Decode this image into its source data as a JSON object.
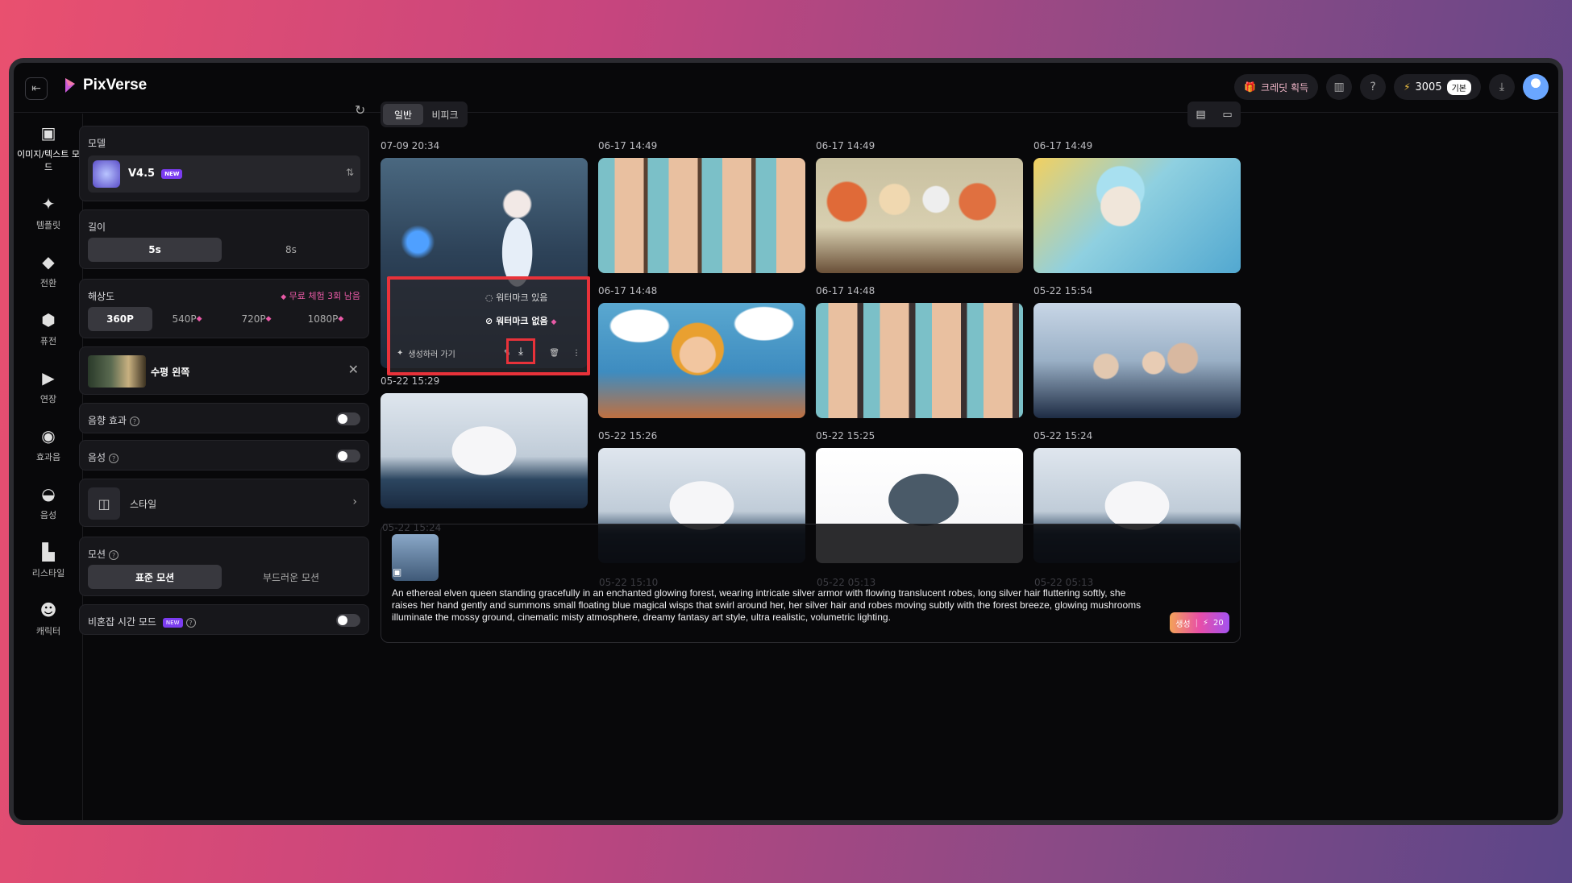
{
  "app": {
    "name": "PixVerse"
  },
  "topbar": {
    "credit_promo": "크레딧 획득",
    "credits": "3005",
    "plan": "기본"
  },
  "nav": [
    {
      "label": "이미지/텍스트 모드",
      "icon": "image-icon"
    },
    {
      "label": "템플릿",
      "icon": "sparkle-icon"
    },
    {
      "label": "전환",
      "icon": "transition-icon"
    },
    {
      "label": "퓨전",
      "icon": "cube-icon"
    },
    {
      "label": "연장",
      "icon": "extend-icon"
    },
    {
      "label": "효과음",
      "icon": "sound-wave-icon"
    },
    {
      "label": "음성",
      "icon": "lips-icon"
    },
    {
      "label": "리스타일",
      "icon": "brush-icon"
    },
    {
      "label": "캐릭터",
      "icon": "face-icon"
    }
  ],
  "settings": {
    "model_label": "모델",
    "model_name": "V4.5",
    "model_badge": "NEW",
    "length_label": "길이",
    "length_options": [
      "5s",
      "8s"
    ],
    "resolution_label": "해상도",
    "free_trial": "무료 체험 3회 남음",
    "resolution_options": [
      "360P",
      "540P",
      "720P",
      "1080P"
    ],
    "camera_move": "수평 왼쪽",
    "sound_effect_label": "음향 효과",
    "voice_label": "음성",
    "style_label": "스타일",
    "motion_label": "모션",
    "motion_options": [
      "표준 모션",
      "부드러운 모션"
    ],
    "off_peak_label": "비혼잡 시간 모드",
    "off_peak_badge": "NEW"
  },
  "gallery": {
    "tabs": [
      "일반",
      "비피크"
    ],
    "items": [
      {
        "date": "07-09 20:34"
      },
      {
        "date": "06-17 14:49"
      },
      {
        "date": "06-17 14:49"
      },
      {
        "date": "06-17 14:49"
      },
      {
        "date": "05-22 15:29"
      },
      {
        "date": "06-17 14:48"
      },
      {
        "date": "06-17 14:48"
      },
      {
        "date": "05-22 15:54"
      },
      {
        "date": "05-22 15:26"
      },
      {
        "date": "05-22 15:25"
      },
      {
        "date": "05-22 15:24"
      }
    ],
    "faded_dates": [
      "05-22 15:24",
      "05-22 15:10",
      "05-22 05:13",
      "05-22 05:13"
    ]
  },
  "popup": {
    "with_watermark": "워터마크 있음",
    "without_watermark": "워터마크 없음",
    "go_generate": "생성하러 가기"
  },
  "prompt": {
    "text": "An ethereal elven queen standing gracefully in an enchanted glowing forest, wearing intricate silver armor with flowing translucent robes, long silver hair fluttering softly, she raises her hand gently and summons small floating blue magical wisps that swirl around her, her silver hair and robes moving subtly with the forest breeze, glowing mushrooms illuminate the mossy ground, cinematic misty atmosphere, dreamy fantasy art style, ultra realistic, volumetric lighting.",
    "generate_label": "생성",
    "cost": "20"
  },
  "colors": {
    "accent": "#e85aa6",
    "highlight": "#e8323a"
  }
}
